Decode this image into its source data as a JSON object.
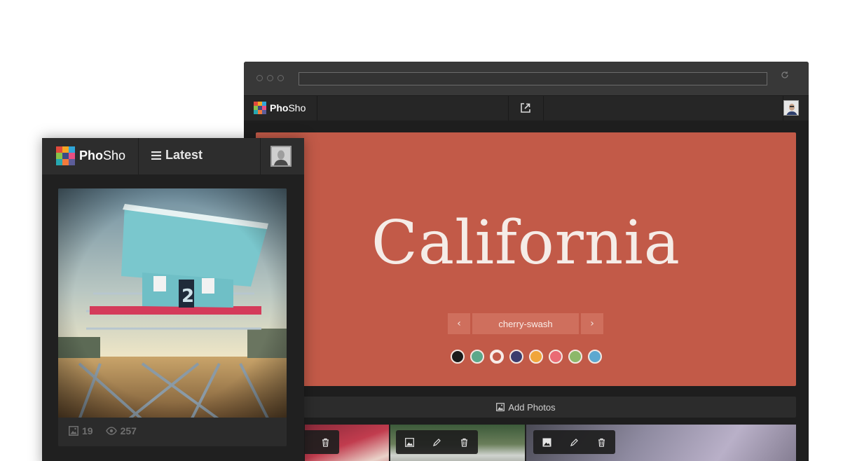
{
  "brand": {
    "bold": "Pho",
    "regular": "Sho"
  },
  "logo_colors": [
    "#e24b3c",
    "#f6a623",
    "#2fa6d9",
    "#8ac249",
    "#3b4a86",
    "#e84f82",
    "#26a8b1",
    "#f27a3b",
    "#5c5d99"
  ],
  "desktop": {
    "hero": {
      "title": "California",
      "background": "#c25a48",
      "font_name": "cherry-swash",
      "prev_glyph": "‹",
      "next_glyph": "›",
      "swatches": [
        "#1b1b1b",
        "#5ba88a",
        "#c25a48",
        "#3c3d6e",
        "#f0a53a",
        "#ea6b74",
        "#8cb86a",
        "#5da8d0"
      ],
      "selected_swatch": 2
    },
    "add_photos_label": "Add Photos"
  },
  "mobile": {
    "menu_label": "Latest",
    "photo_count": "19",
    "view_count": "257"
  }
}
